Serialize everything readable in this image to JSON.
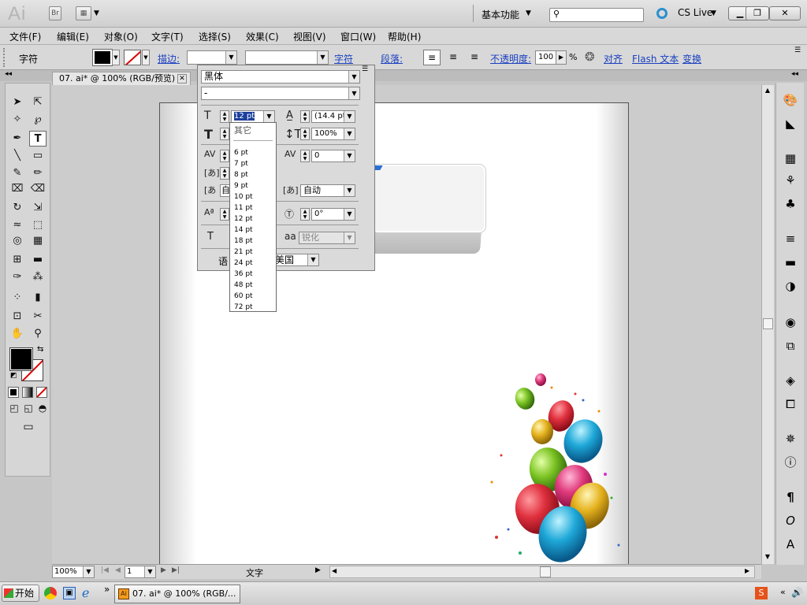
{
  "titlebar": {
    "logo": "Ai",
    "bridge": "Br",
    "workspace": "基本功能",
    "cslive": "CS Live",
    "minimize": "▁",
    "restore": "❐",
    "close": "✕"
  },
  "menu": [
    "文件(F)",
    "编辑(E)",
    "对象(O)",
    "文字(T)",
    "选择(S)",
    "效果(C)",
    "视图(V)",
    "窗口(W)",
    "帮助(H)"
  ],
  "control": {
    "label": "字符",
    "stroke": "描边:",
    "char_link": "字符",
    "para": "段落:",
    "opacity": "不透明度:",
    "opacity_value": "100",
    "opacity_unit": "%",
    "align": "对齐",
    "flash": "Flash 文本",
    "transform": "变换"
  },
  "document": {
    "tab_title": "07. ai* @ 100% (RGB/预览)",
    "zoom": "100%",
    "page": "1",
    "status": "文字"
  },
  "char_panel": {
    "font_family": "黑体",
    "font_style": "-",
    "font_size": "12 pt",
    "leading": "(14.4 pt)",
    "vscale": "100%",
    "tracking": "0",
    "auto": "自",
    "kern_auto": "自动",
    "rotation": "0°",
    "antialias": "锐化",
    "language_prefix": "语",
    "language": "美国"
  },
  "size_list": {
    "other": "其它",
    "options": [
      "6 pt",
      "7 pt",
      "8 pt",
      "9 pt",
      "10 pt",
      "11 pt",
      "12 pt",
      "14 pt",
      "18 pt",
      "21 pt",
      "24 pt",
      "36 pt",
      "48 pt",
      "60 pt",
      "72 pt"
    ]
  },
  "taskbar": {
    "start": "开始",
    "task": "07. ai* @ 100% (RGB/...",
    "more": "»"
  },
  "colors": {
    "link": "#1a40c0",
    "selection": "#1c3f9c"
  }
}
